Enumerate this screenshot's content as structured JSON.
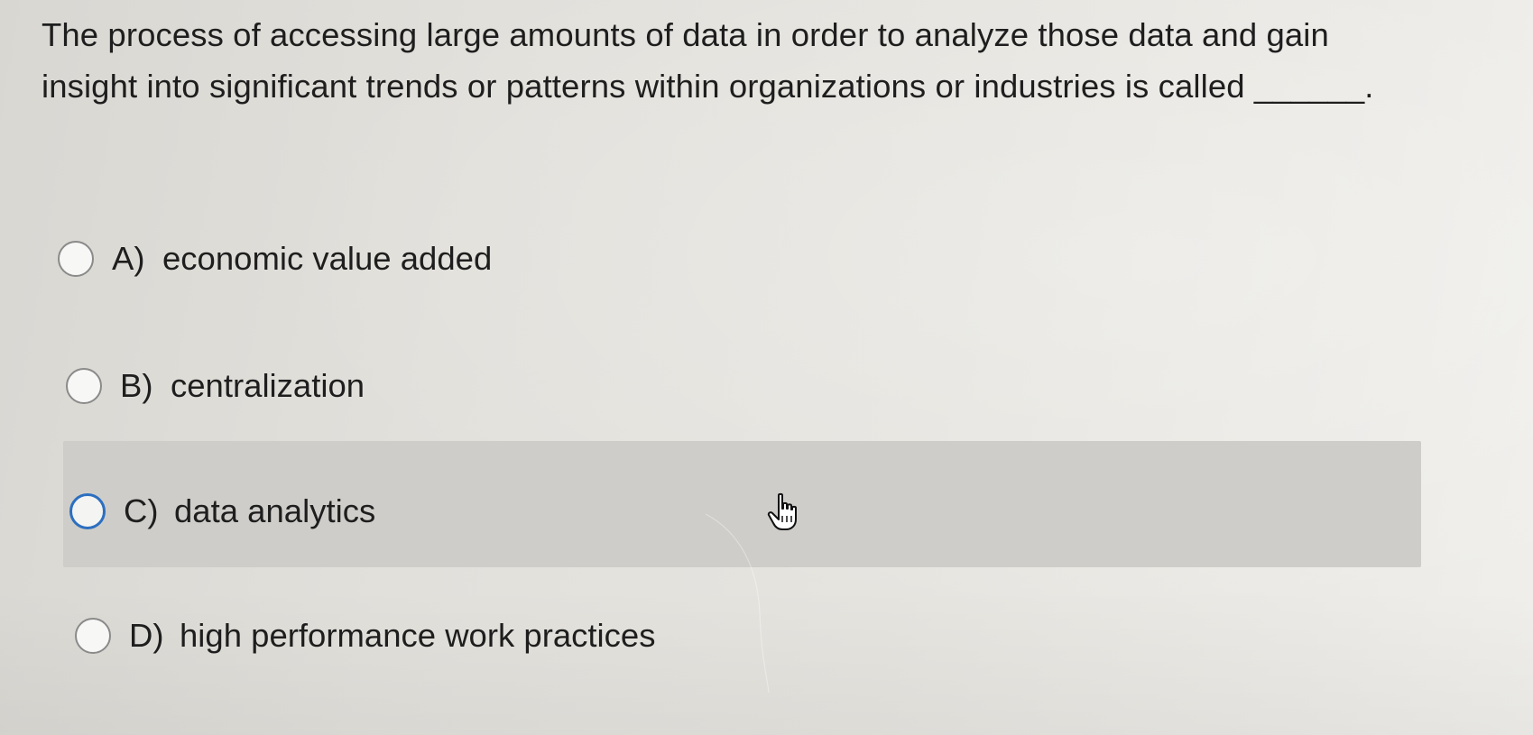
{
  "question": {
    "text": "The process of accessing large amounts of data in order to analyze those data and gain insight into significant trends or patterns within organizations or industries is called ______."
  },
  "options": [
    {
      "letter": "A)",
      "text": "economic value added"
    },
    {
      "letter": "B)",
      "text": "centralization"
    },
    {
      "letter": "C)",
      "text": "data analytics"
    },
    {
      "letter": "D)",
      "text": "high performance work practices"
    }
  ],
  "state": {
    "hovered_option": "C",
    "cursor_icon": "hand-pointer-icon"
  },
  "colors": {
    "text": "#1e1e1e",
    "radio_border": "#8a8a8a",
    "radio_focus": "#2c6fc0",
    "hover_band": "#cfcdc9"
  }
}
